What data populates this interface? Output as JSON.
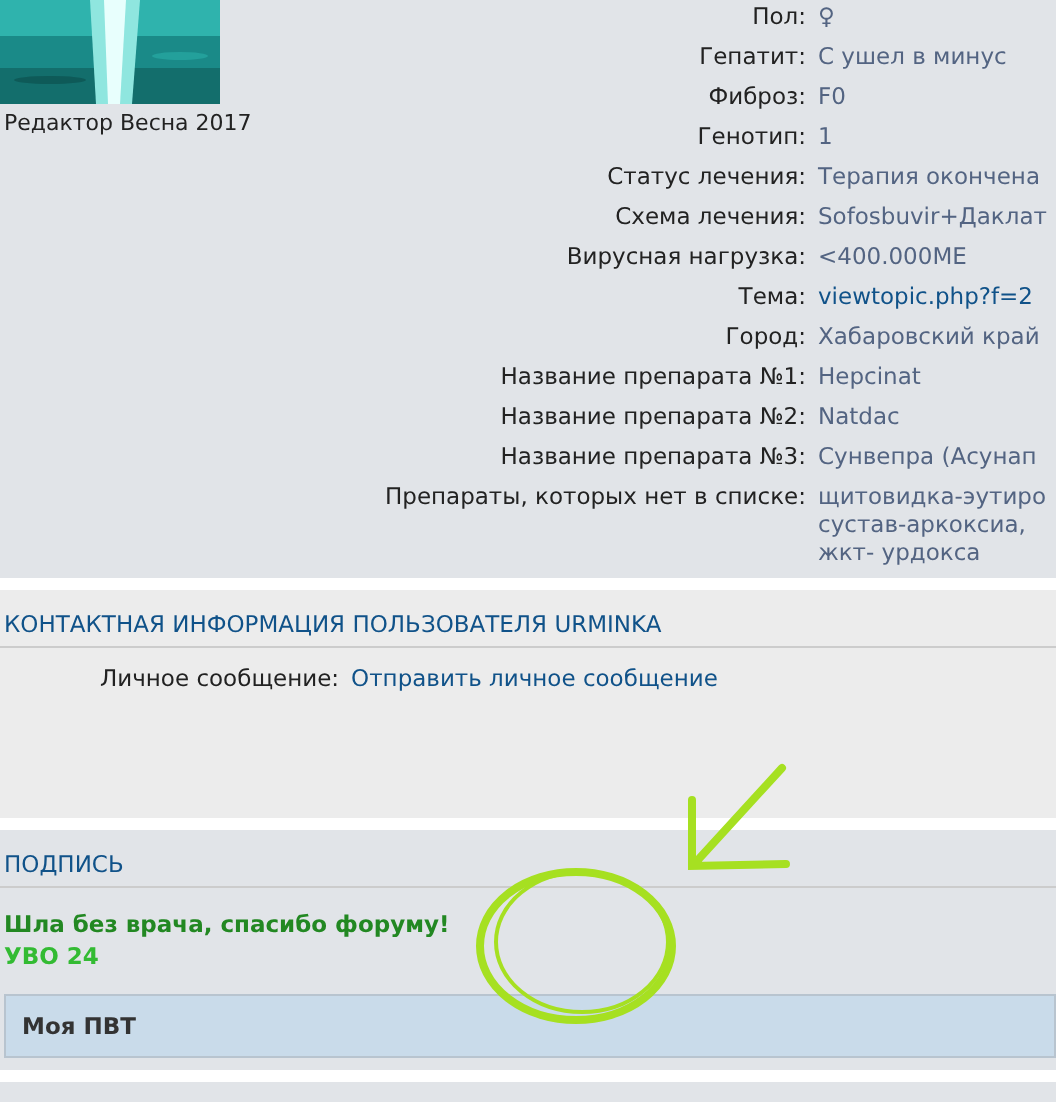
{
  "profile": {
    "avatar_caption": "Редактор Весна 2017",
    "fields": [
      {
        "label": "Пол:",
        "value": [
          "♀"
        ],
        "kind": "text"
      },
      {
        "label": "Гепатит:",
        "value": [
          "С ушел в минус"
        ],
        "kind": "text"
      },
      {
        "label": "Фиброз:",
        "value": [
          "F0"
        ],
        "kind": "text"
      },
      {
        "label": "Генотип:",
        "value": [
          "1"
        ],
        "kind": "text"
      },
      {
        "label": "Статус лечения:",
        "value": [
          "Терапия окончена"
        ],
        "kind": "text"
      },
      {
        "label": "Схема лечения:",
        "value": [
          "Sofosbuvir+Даклат"
        ],
        "kind": "text"
      },
      {
        "label": "Вирусная нагрузка:",
        "value": [
          "<400.000МЕ"
        ],
        "kind": "text"
      },
      {
        "label": "Тема:",
        "value": [
          "viewtopic.php?f=2"
        ],
        "kind": "link"
      },
      {
        "label": "Город:",
        "value": [
          "Хабаровский край"
        ],
        "kind": "text"
      },
      {
        "label": "Название препарата №1:",
        "value": [
          "Hepcinat"
        ],
        "kind": "text"
      },
      {
        "label": "Название препарата №2:",
        "value": [
          "Natdac"
        ],
        "kind": "text"
      },
      {
        "label": "Название препарата №3:",
        "value": [
          "Сунвепра (Асунап"
        ],
        "kind": "text"
      },
      {
        "label": "Препараты, которых нет в списке:",
        "value": [
          "щитовидка-эутиро",
          "сустав-аркоксиа,",
          "жкт- урдокса"
        ],
        "kind": "text"
      }
    ]
  },
  "contact": {
    "heading": "КОНТАКТНАЯ ИНФОРМАЦИЯ ПОЛЬЗОВАТЕЛЯ URMINKA",
    "rows": [
      {
        "label": "Личное сообщение:",
        "link": "Отправить личное сообщение"
      }
    ]
  },
  "signature": {
    "heading": "ПОДПИСЬ",
    "lines": [
      {
        "text": "Шла без врача, спасибо форуму!",
        "color": "#228822"
      },
      {
        "text": "УВО 24",
        "color": "#33bb33"
      }
    ],
    "spoiler": "Моя ПВТ"
  },
  "annotations": {
    "circle": true,
    "arrow": true
  }
}
